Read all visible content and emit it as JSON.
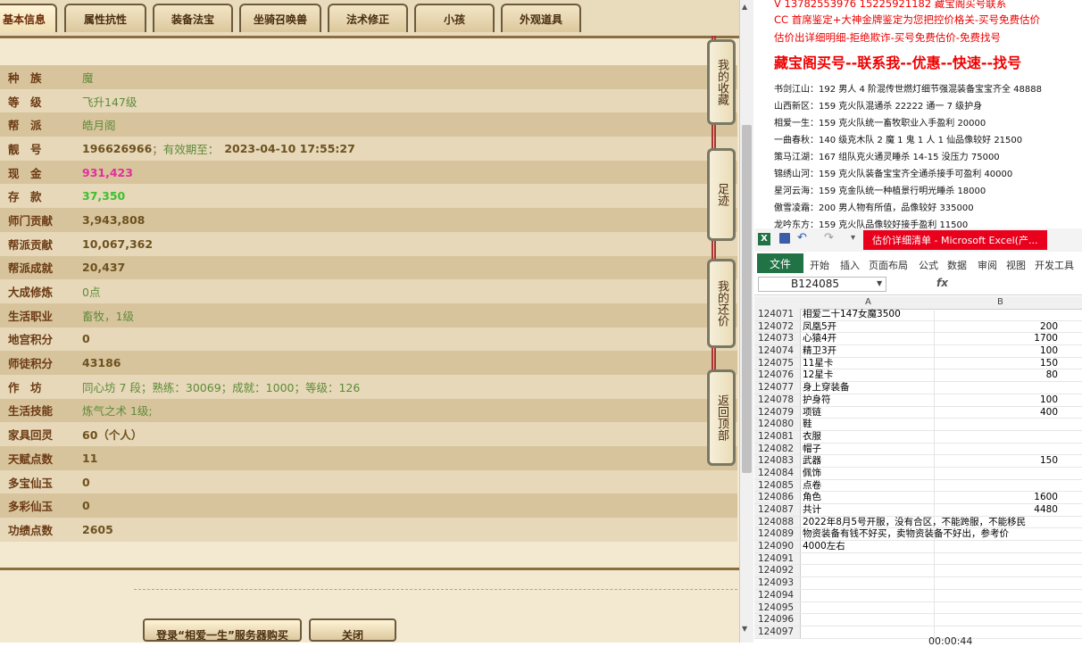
{
  "game": {
    "tabs": [
      "基本信息",
      "属性抗性",
      "装备法宝",
      "坐骑召唤兽",
      "法术修正",
      "小孩",
      "外观道具"
    ],
    "rows": [
      {
        "label": "种　族",
        "value": "魔",
        "style": "green"
      },
      {
        "label": "等　级",
        "value": "飞升147级",
        "style": "green"
      },
      {
        "label": "帮　派",
        "value": "皓月阁",
        "style": "green"
      },
      {
        "label": "靓　号",
        "value": "196626966",
        "sub": "有效期至：",
        "value2": "2023-04-10 17:55:27",
        "style": "normal"
      },
      {
        "label": "现　金",
        "value": "931,423",
        "style": "pink"
      },
      {
        "label": "存　款",
        "value": "37,350",
        "style": "lgreen"
      },
      {
        "label": "师门贡献",
        "value": "3,943,808",
        "style": "normal"
      },
      {
        "label": "帮派贡献",
        "value": "10,067,362",
        "style": "normal"
      },
      {
        "label": "帮派成就",
        "value": "20,437",
        "style": "normal"
      },
      {
        "label": "大成修炼",
        "value": "0点",
        "style": "green"
      },
      {
        "label": "生活职业",
        "value": "畜牧，1级",
        "style": "green"
      },
      {
        "label": "地宫积分",
        "value": "0",
        "style": "normal"
      },
      {
        "label": "师徒积分",
        "value": "43186",
        "style": "normal"
      },
      {
        "label": "作　坊",
        "value": "同心坊 7 段；熟练：30069；成就：1000；等级：126",
        "style": "green"
      },
      {
        "label": "生活技能",
        "value": "炼气之术 1级;",
        "style": "green"
      },
      {
        "label": "家具回灵",
        "value": "60（个人）",
        "style": "green"
      },
      {
        "label": "天赋点数",
        "value": "11",
        "style": "normal"
      },
      {
        "label": "多宝仙玉",
        "value": "0",
        "style": "normal"
      },
      {
        "label": "多彩仙玉",
        "value": "0",
        "style": "normal"
      },
      {
        "label": "功绩点数",
        "value": "2605",
        "style": "normal"
      }
    ],
    "side_buttons": [
      "我的收藏",
      "足迹",
      "我的还价",
      "返回顶部"
    ],
    "bottom_buttons": [
      "登录“相爱一生”服务器购买",
      "关闭"
    ]
  },
  "ad": {
    "line1": "V 13782553976  15225921182  藏宝阁买号联系",
    "line2": "CC 首席鉴定+大神金牌鉴定为您把控价格关-买号免费估价",
    "line3": "估价出详细明细-拒绝欺诈-买号免费估价-免费找号",
    "headline": "藏宝阁买号--联系我--优惠--快速--找号",
    "items": [
      "书剑江山：192 男人 4 阶混传世燃灯细节强混装备宝宝齐全 48888",
      "山西新区：159 克火队混通杀 22222 通一 7 级护身",
      "相爱一生：159 克火队统一畜牧职业入手盈利 20000",
      "一曲春秋：140 级克木队 2 魔 1 鬼 1 人 1 仙品像较好 21500",
      "策马江湖：167 组队克火通灵睡杀 14-15 没压力 75000",
      "锦绣山河：159 克火队装备宝宝齐全通杀接手可盈利 40000",
      "星河云海：159 克金队统一种植景行明光睡杀 18000",
      "傲雪凌霜：200 男人物有所值，品像较好 335000",
      "龙吟东方：159 克火队品像较好接手盈利 11500"
    ]
  },
  "excel": {
    "window_title": "估价详细清单 - Microsoft Excel(产...",
    "file_tab": "文件",
    "tabs": [
      "开始",
      "插入",
      "页面布局",
      "公式",
      "数据",
      "审阅",
      "视图",
      "开发工具"
    ],
    "name_box": "B124085",
    "fx": "fx",
    "columns": [
      "A",
      "B"
    ],
    "rows": [
      {
        "n": "124071",
        "a": "相爱二十147女魔3500",
        "b": ""
      },
      {
        "n": "124072",
        "a": "凤凰5开",
        "b": "200"
      },
      {
        "n": "124073",
        "a": "心猿4开",
        "b": "1700"
      },
      {
        "n": "124074",
        "a": "精卫3开",
        "b": "100"
      },
      {
        "n": "124075",
        "a": "11星卡",
        "b": "150"
      },
      {
        "n": "124076",
        "a": "12星卡",
        "b": "80"
      },
      {
        "n": "124077",
        "a": "身上穿装备",
        "b": ""
      },
      {
        "n": "124078",
        "a": "护身符",
        "b": "100"
      },
      {
        "n": "124079",
        "a": "项链",
        "b": "400"
      },
      {
        "n": "124080",
        "a": "鞋",
        "b": ""
      },
      {
        "n": "124081",
        "a": "衣服",
        "b": ""
      },
      {
        "n": "124082",
        "a": "帽子",
        "b": ""
      },
      {
        "n": "124083",
        "a": "武器",
        "b": "150"
      },
      {
        "n": "124084",
        "a": "佩饰",
        "b": ""
      },
      {
        "n": "124085",
        "a": "点卷",
        "b": ""
      },
      {
        "n": "124086",
        "a": "角色",
        "b": "1600"
      },
      {
        "n": "124087",
        "a": "共计",
        "b": "4480"
      },
      {
        "n": "124088",
        "a": "2022年8月5号开服，没有合区，不能跨服，不能移民",
        "b": ""
      },
      {
        "n": "124089",
        "a": "物资装备有钱不好买，卖物资装备不好出，参考价",
        "b": ""
      },
      {
        "n": "124090",
        "a": "4000左右",
        "b": ""
      },
      {
        "n": "124091",
        "a": "",
        "b": ""
      },
      {
        "n": "124092",
        "a": "",
        "b": ""
      },
      {
        "n": "124093",
        "a": "",
        "b": ""
      },
      {
        "n": "124094",
        "a": "",
        "b": ""
      },
      {
        "n": "124095",
        "a": "",
        "b": ""
      },
      {
        "n": "124096",
        "a": "",
        "b": ""
      },
      {
        "n": "124097",
        "a": "",
        "b": ""
      }
    ]
  },
  "recording": {
    "time": "00:00:44"
  }
}
